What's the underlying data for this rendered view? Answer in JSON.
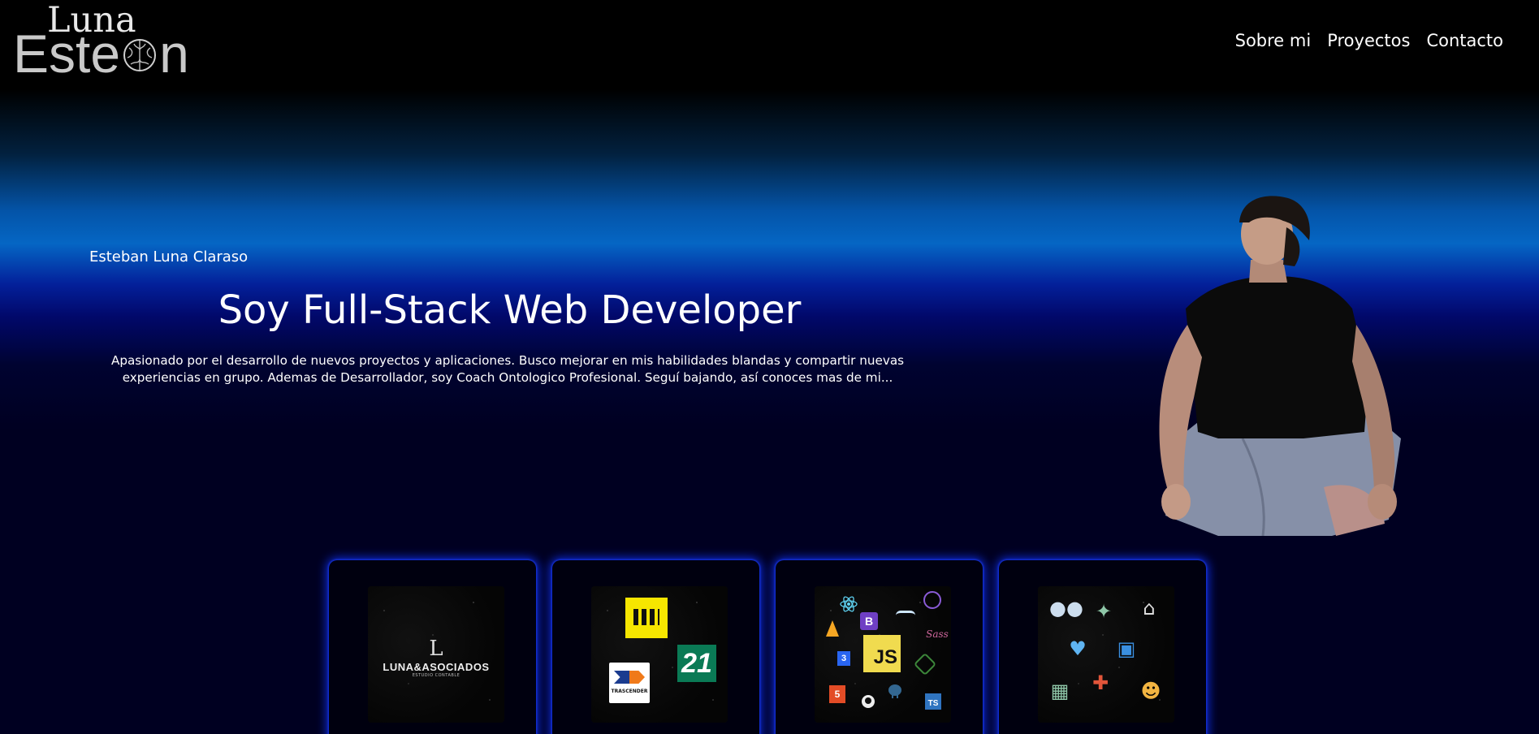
{
  "logo": {
    "top": "Luna",
    "bottom_start": "Este",
    "bottom_end": "n"
  },
  "nav": {
    "items": [
      "Sobre mi",
      "Proyectos",
      "Contacto"
    ]
  },
  "hero": {
    "name": "Esteban Luna Claraso",
    "title": "Soy Full-Stack Web Developer",
    "description": "Apasionado por el desarrollo de nuevos proyectos y aplicaciones. Busco mejorar en mis habilidades blandas y compartir nuevas experiencias en grupo. Ademas de Desarrollador, soy Coach Ontologico Profesional. Seguí bajando, así conoces mas de mi..."
  },
  "cards": {
    "luna": {
      "mark": "L",
      "name": "LUNA&ASOCIADOS",
      "sub": "ESTUDIO CONTABLE"
    },
    "projects": {
      "label_21": "21",
      "label_tras": "TRASCENDER"
    },
    "tech": {
      "js": "JS",
      "ts": "TS",
      "b": "B",
      "sass": "Sass",
      "html": "5",
      "css": "3"
    }
  },
  "colors": {
    "accent_glow": "#0d2ad8",
    "hero_blue": "#0566c4",
    "background": "#000021"
  }
}
